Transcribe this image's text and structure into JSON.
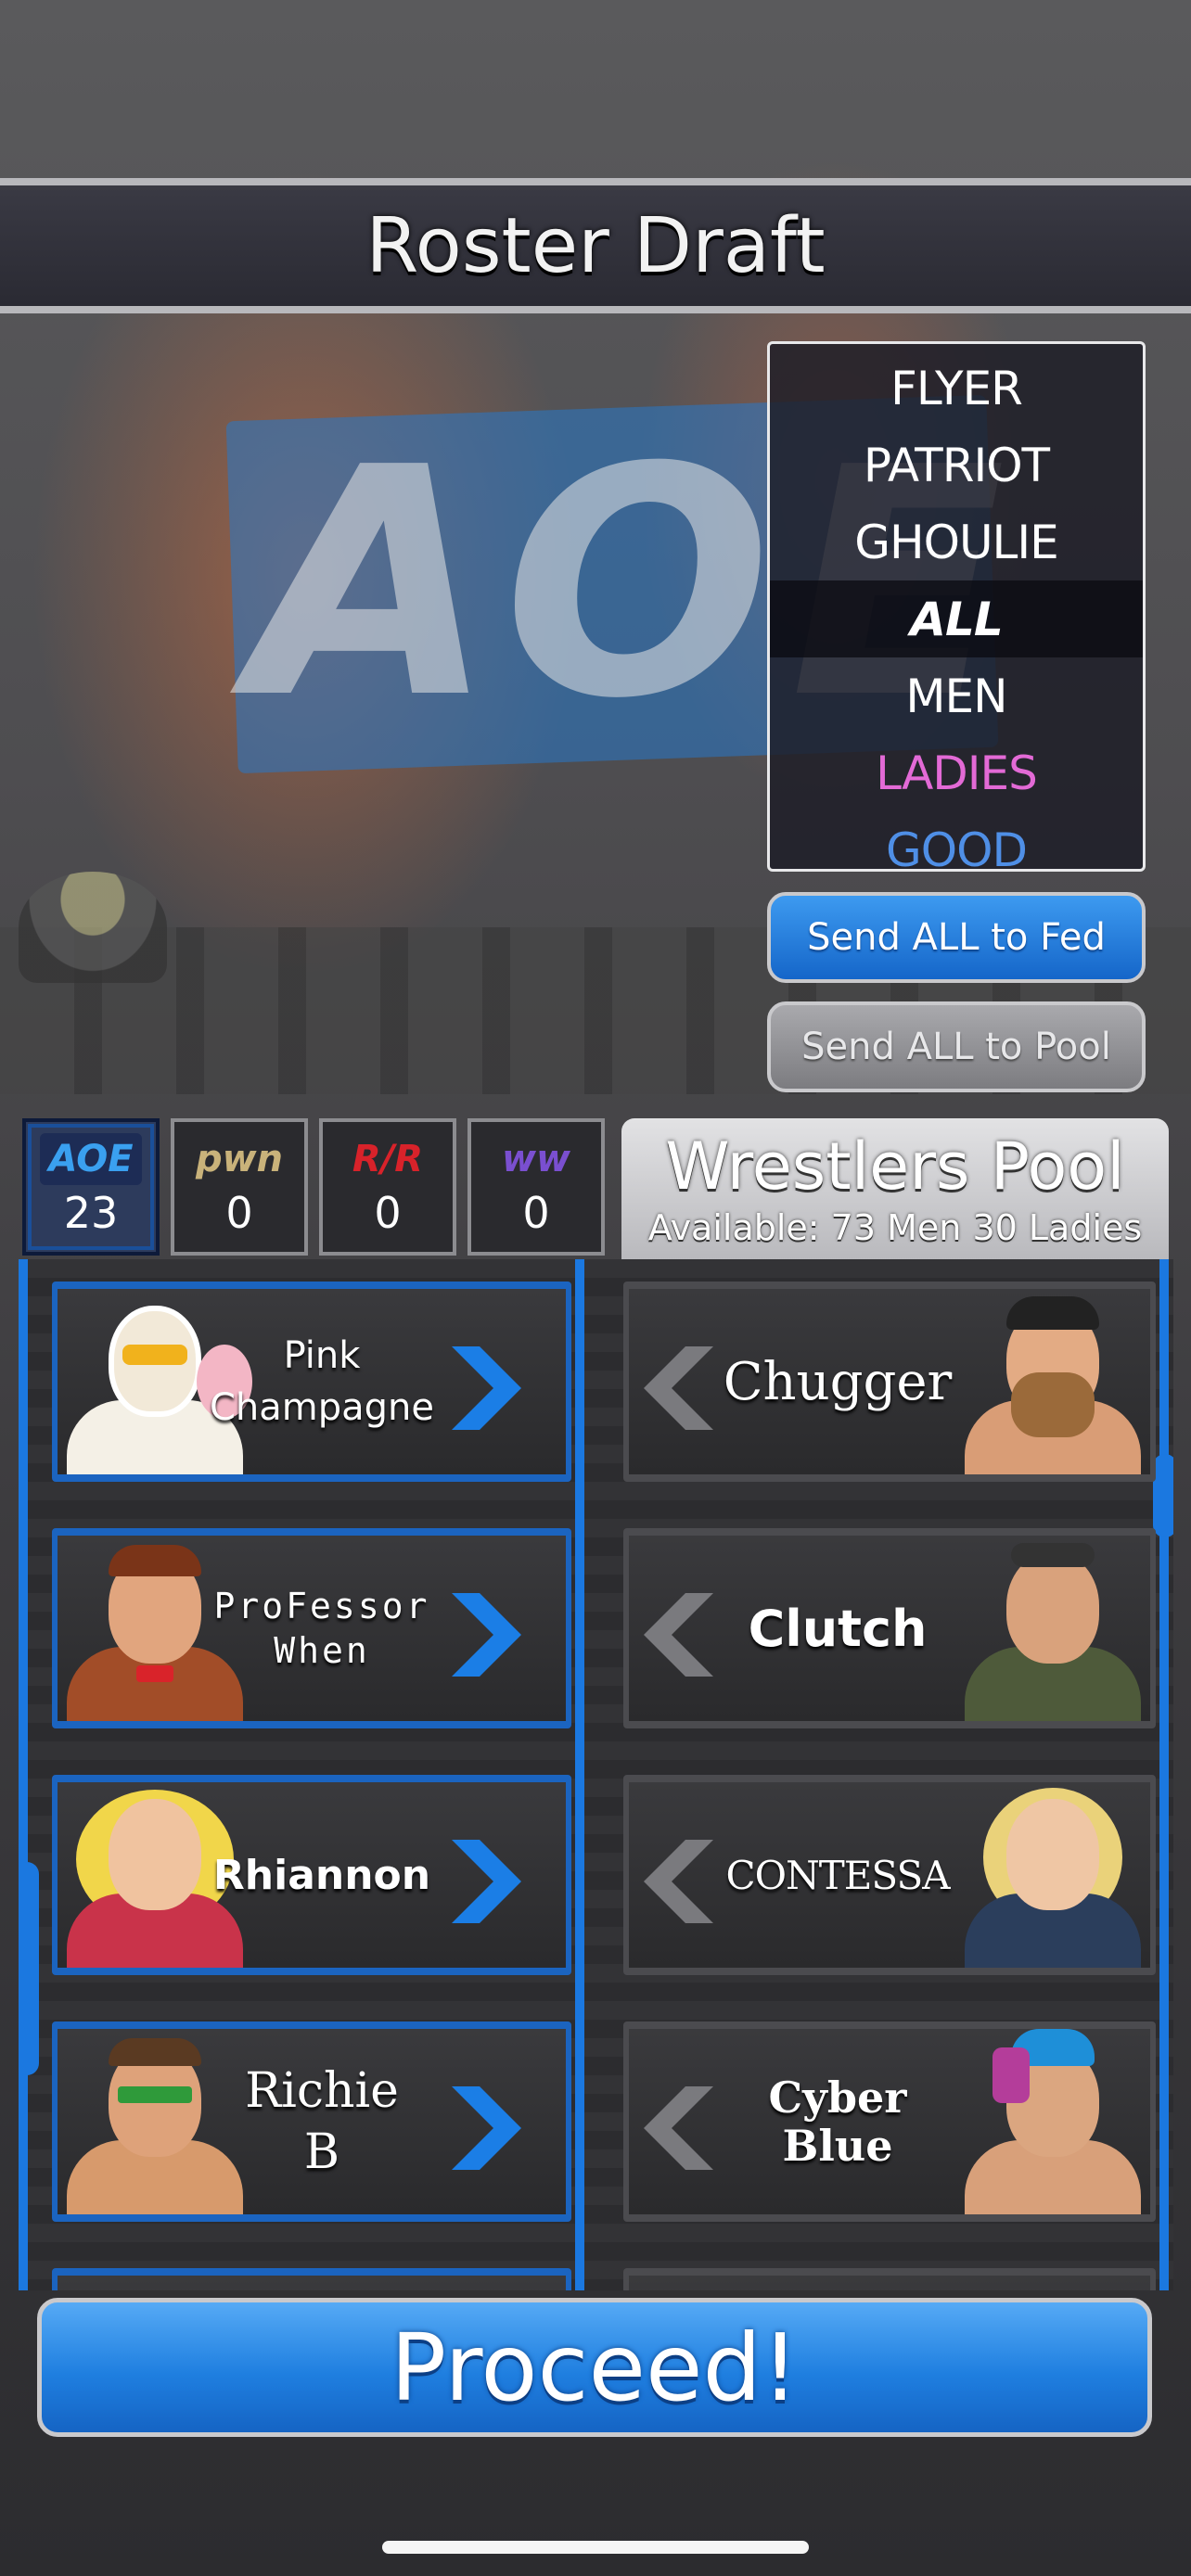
{
  "title": "Roster Draft",
  "background_logo": "AOE",
  "filters": [
    {
      "label": "FLYER",
      "active": false,
      "color": "#ffffff"
    },
    {
      "label": "PATRIOT",
      "active": false,
      "color": "#ffffff"
    },
    {
      "label": "GHOULIE",
      "active": false,
      "color": "#ffffff"
    },
    {
      "label": "ALL",
      "active": true,
      "color": "#ffffff"
    },
    {
      "label": "MEN",
      "active": false,
      "color": "#ffffff"
    },
    {
      "label": "LADIES",
      "active": false,
      "color": "#e36ad6"
    },
    {
      "label": "GOOD",
      "active": false,
      "color": "#4f8fe6"
    }
  ],
  "buttons": {
    "send_all_fed": "Send ALL to Fed",
    "send_all_pool": "Send ALL to Pool",
    "proceed": "Proceed!"
  },
  "federations": [
    {
      "logo": "AOE",
      "count": "23",
      "active": true,
      "logo_color": "#3aa0f0"
    },
    {
      "logo": "pwn",
      "count": "0",
      "active": false,
      "logo_color": "#c9b27a"
    },
    {
      "logo": "R/R",
      "count": "0",
      "active": false,
      "logo_color": "#d8222a"
    },
    {
      "logo": "ww",
      "count": "0",
      "active": false,
      "logo_color": "#7a4fd0"
    }
  ],
  "pool": {
    "title": "Wrestlers Pool",
    "available": "Available: 73 Men 30 Ladies"
  },
  "fed_roster": [
    {
      "name_line1": "Pink",
      "name_line2": "Champagne"
    },
    {
      "name_line1": "ProFessor",
      "name_line2": "When"
    },
    {
      "name_line1": "Rhiannon",
      "name_line2": ""
    },
    {
      "name_line1": "Richie",
      "name_line2": "B"
    }
  ],
  "pool_roster": [
    {
      "name_line1": "Chugger",
      "name_line2": ""
    },
    {
      "name_line1": "Clutch",
      "name_line2": ""
    },
    {
      "name_line1": "CONTESSA",
      "name_line2": ""
    },
    {
      "name_line1": "Cyber",
      "name_line2": "Blue"
    }
  ],
  "colors": {
    "accent_blue": "#1b78e0",
    "ladies": "#e36ad6",
    "good": "#4f8fe6",
    "arrow_blue": "#1b7ee6",
    "arrow_grey": "#7a7a7e"
  }
}
